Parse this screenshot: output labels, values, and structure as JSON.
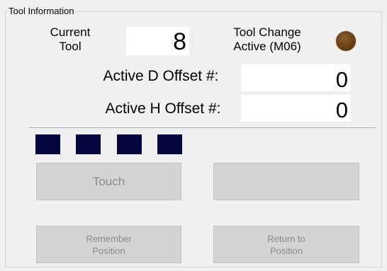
{
  "group": {
    "title": "Tool Information"
  },
  "current_tool": {
    "label": "Current\nTool",
    "value": "8"
  },
  "tool_change": {
    "label": "Tool Change\nActive (M06)",
    "led_color": "#6b3f16"
  },
  "d_offset": {
    "label": "Active D Offset #:",
    "value": "0"
  },
  "h_offset": {
    "label": "Active H Offset #:",
    "value": "0"
  },
  "indicators": {
    "color": "#06063f",
    "count": 4
  },
  "buttons": {
    "touch_label": "Touch",
    "blank_label": "",
    "remember_label": "Remember\nPosition",
    "return_label": "Return to\nPosition"
  }
}
